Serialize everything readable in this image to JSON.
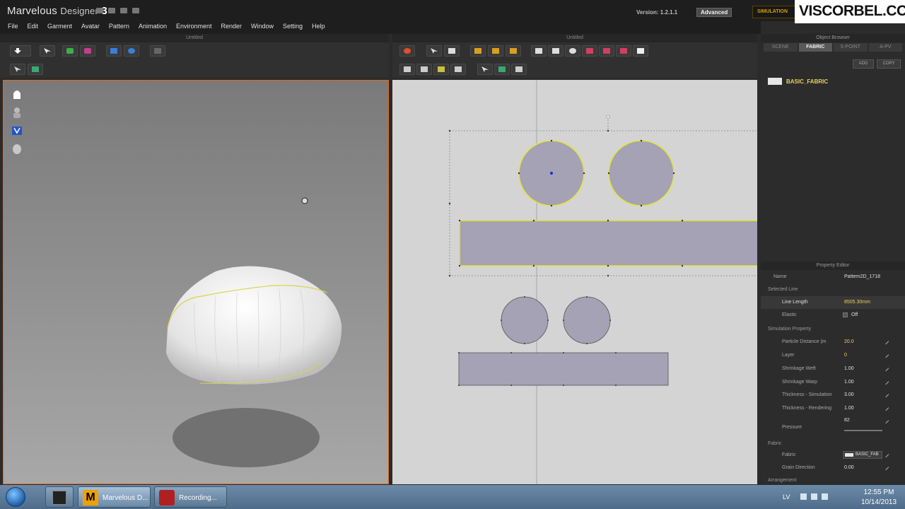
{
  "window": {
    "app_name": "Marvelous",
    "app_subtitle": "Designer",
    "app_version_digit": "3",
    "version_text": "Version:   1.2.1.1",
    "mode": "Advanced",
    "simulation_badge": "SIMULATION",
    "watermark": "VISCORBEL.COM"
  },
  "menu": [
    "File",
    "Edit",
    "Garment",
    "Avatar",
    "Pattern",
    "Animation",
    "Environment",
    "Render",
    "Window",
    "Setting",
    "Help"
  ],
  "panels": {
    "left_title": "Untitled",
    "right_title": "Untitled"
  },
  "object_browser": {
    "title": "Object Browser",
    "tabs": [
      "SCENE",
      "FABRIC",
      "S-POINT",
      "A-PV"
    ],
    "active_tab": "FABRIC",
    "add_label": "ADD",
    "copy_label": "COPY",
    "fabric_name": "BASIC_FABRIC"
  },
  "property_editor": {
    "title": "Property Editor",
    "name_label": "Name",
    "name_value": "Pattern2D_1718",
    "section_selected_line": "Selected Line",
    "line_length_label": "Line Length",
    "line_length_value": "8505.30mm",
    "elastic_label": "Elastic",
    "elastic_value": "Off",
    "section_simulation": "Simulation Property",
    "rows": [
      {
        "label": "Particle Distance (m",
        "value": "20.0",
        "highlight": true
      },
      {
        "label": "Layer",
        "value": "0",
        "highlight": true
      },
      {
        "label": "Shrinkage Weft",
        "value": "1.00",
        "highlight": false
      },
      {
        "label": "Shrinkage Warp",
        "value": "1.00",
        "highlight": false
      },
      {
        "label": "Thickness - Simulation",
        "value": "3.00",
        "highlight": false
      },
      {
        "label": "Thickness - Rendering",
        "value": "1.00",
        "highlight": false
      }
    ],
    "pressure_label": "Pressure",
    "pressure_value": "82",
    "section_fabric": "Fabric",
    "fabric_label": "Fabric",
    "fabric_value": "BASIC_FAB",
    "grain_label": "Grain Direction",
    "grain_value": "0.00",
    "section_arrangement": "Arrangement"
  },
  "taskbar": {
    "items": [
      "Marvelous D...",
      "Recording..."
    ],
    "language": "LV",
    "time": "12:55 PM",
    "date": "10/14/2013"
  }
}
